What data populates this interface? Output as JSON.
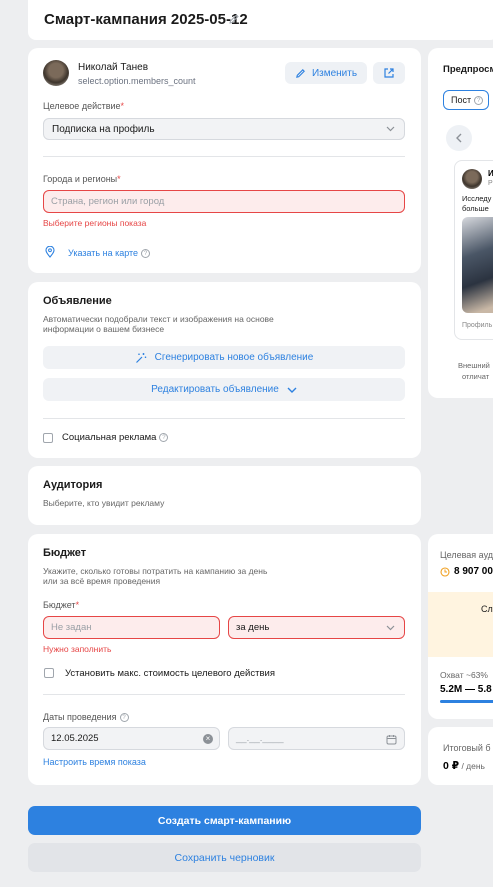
{
  "header": {
    "title": "Смарт-кампания 2025-05-12"
  },
  "account": {
    "name": "Николай Танев",
    "subtitle": "select.option.members_count",
    "change_label": "Изменить"
  },
  "target_action": {
    "label": "Целевое действие",
    "value": "Подписка на профиль"
  },
  "regions": {
    "label": "Города и регионы",
    "placeholder": "Страна, регион или город",
    "error": "Выберите регионы показа",
    "map_link": "Указать на карте"
  },
  "ad": {
    "title": "Объявление",
    "description_line1": "Автоматически подобрали текст и изображения на основе",
    "description_line2": "информации о вашем бизнесе",
    "generate_label": "Сгенерировать новое объявление",
    "edit_label": "Редактировать объявление",
    "social_label": "Социальная реклама"
  },
  "audience": {
    "title": "Аудитория",
    "description": "Выберите, кто увидит рекламу"
  },
  "budget": {
    "title": "Бюджет",
    "description_line1": "Укажите, сколько готовы потратить на кампанию за день",
    "description_line2": "или за всё время проведения",
    "label": "Бюджет",
    "placeholder": "Не задан",
    "error": "Нужно заполнить",
    "period_value": "за день",
    "max_cost_label": "Установить макс. стоимость целевого действия",
    "dates_label": "Даты проведения",
    "start_date": "12.05.2025",
    "end_placeholder": "__.__.____",
    "schedule_link": "Настроить время показа"
  },
  "actions": {
    "create_label": "Создать смарт-кампанию",
    "draft_label": "Сохранить черновик"
  },
  "preview": {
    "title": "Предпросм",
    "tab_post": "Пост",
    "avatar_initial": "И",
    "avatar_sub": "Р",
    "text_line1": "Исследу",
    "text_line2": "больше",
    "profile_label": "Профиль",
    "footer_line1": "Внешний",
    "footer_line2": "отличат"
  },
  "forecast": {
    "audience_label": "Целевая ауд",
    "audience_value": "8 907 00",
    "banner_text": "Сл",
    "reach_label": "Охват ~63%",
    "reach_value": "5.2M — 5.8",
    "reach_progress": 0.63
  },
  "total": {
    "label": "Итоговый б",
    "value": "0 ₽",
    "unit": " / день"
  }
}
